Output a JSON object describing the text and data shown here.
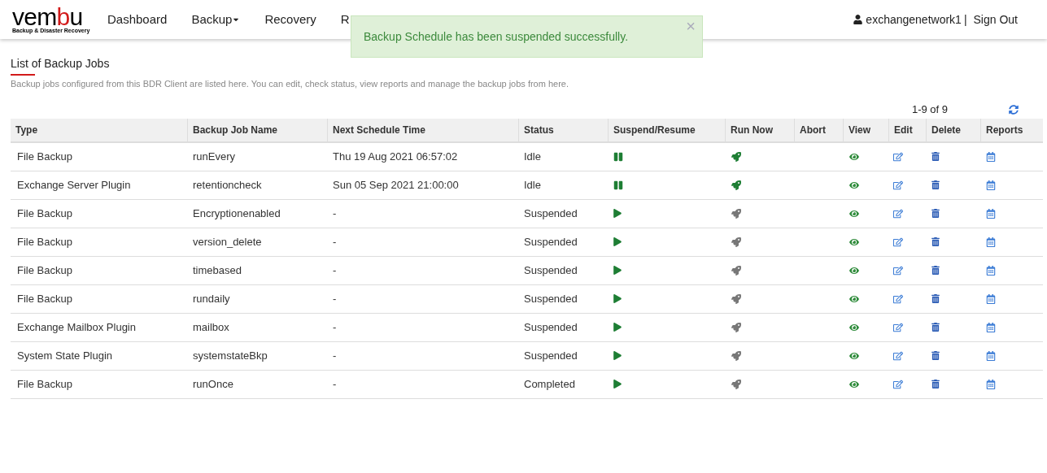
{
  "logo": {
    "name": "vembu",
    "tagline": "Backup & Disaster Recovery"
  },
  "nav": [
    {
      "label": "Dashboard",
      "dropdown": false
    },
    {
      "label": "Backup",
      "dropdown": true
    },
    {
      "label": "Recovery",
      "dropdown": false
    },
    {
      "label": "R",
      "dropdown": false
    }
  ],
  "user": {
    "name": "exchangenetwork1",
    "separator": "|",
    "signout": "Sign Out"
  },
  "toast": {
    "message": "Backup Schedule has been suspended successfully.",
    "close": "×"
  },
  "page": {
    "title": "List of Backup Jobs",
    "description": "Backup jobs configured from this BDR Client are listed here. You can edit, check status, view reports and manage the backup jobs from here."
  },
  "pagination": "1-9 of 9",
  "table": {
    "columns": [
      "Type",
      "Backup Job Name",
      "Next Schedule Time",
      "Status",
      "Suspend/Resume",
      "Run Now",
      "Abort",
      "View",
      "Edit",
      "Delete",
      "Reports"
    ],
    "rows": [
      {
        "type": "File Backup",
        "name": "runEvery",
        "next": "Thu 19 Aug 2021 06:57:02",
        "status": "Idle",
        "kind": "pause",
        "run_enabled": true
      },
      {
        "type": "Exchange Server Plugin",
        "name": "retentioncheck",
        "next": "Sun 05 Sep 2021 21:00:00",
        "status": "Idle",
        "kind": "pause",
        "run_enabled": true
      },
      {
        "type": "File Backup",
        "name": "Encryptionenabled",
        "next": "-",
        "status": "Suspended",
        "kind": "resume",
        "run_enabled": false
      },
      {
        "type": "File Backup",
        "name": "version_delete",
        "next": "-",
        "status": "Suspended",
        "kind": "resume",
        "run_enabled": false
      },
      {
        "type": "File Backup",
        "name": "timebased",
        "next": "-",
        "status": "Suspended",
        "kind": "resume",
        "run_enabled": false
      },
      {
        "type": "File Backup",
        "name": "rundaily",
        "next": "-",
        "status": "Suspended",
        "kind": "resume",
        "run_enabled": false
      },
      {
        "type": "Exchange Mailbox Plugin",
        "name": "mailbox",
        "next": "-",
        "status": "Suspended",
        "kind": "resume",
        "run_enabled": false
      },
      {
        "type": "System State Plugin",
        "name": "systemstateBkp",
        "next": "-",
        "status": "Suspended",
        "kind": "resume",
        "run_enabled": false
      },
      {
        "type": "File Backup",
        "name": "runOnce",
        "next": "-",
        "status": "Completed",
        "kind": "resume",
        "run_enabled": false
      }
    ]
  }
}
